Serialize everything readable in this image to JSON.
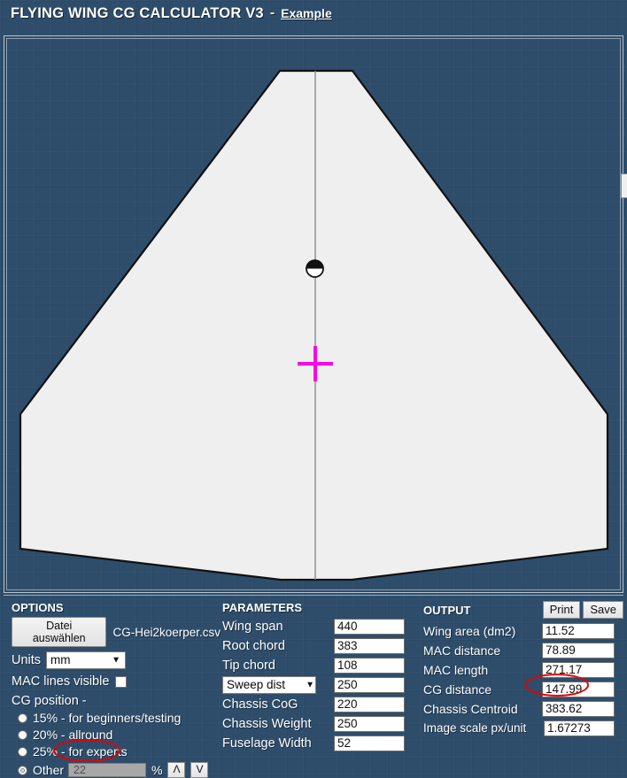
{
  "header": {
    "title": "FLYING WING CG CALCULATOR V3",
    "separator": "-",
    "example_link": "Example"
  },
  "diagram": {
    "markers": {
      "cg_marker": "cg-target-marker",
      "centroid_marker": "magenta-cross-marker"
    },
    "wing_fill": "#efefef",
    "outline_color": "#111111",
    "centerline_color": "#8a8a8a",
    "cross_color": "#ff00e6"
  },
  "options": {
    "title": "OPTIONS",
    "file_button": "Datei auswählen",
    "file_name": "CG-Hei2koerper.csv",
    "units_label": "Units",
    "units_value": "mm",
    "units_options": [
      "mm"
    ],
    "mac_lines_label": "MAC lines visible",
    "mac_lines_checked": false,
    "cg_position_label": "CG position -",
    "cg_options": [
      {
        "label": "15% - for beginners/testing",
        "selected": false
      },
      {
        "label": "20% - allround",
        "selected": false
      },
      {
        "label": "25% - for experts",
        "selected": false
      }
    ],
    "other_label": "Other",
    "other_selected": true,
    "other_value": "22",
    "percent_sign": "%",
    "spin_up": "Λ",
    "spin_down": "V"
  },
  "parameters": {
    "title": "PARAMETERS",
    "rows": [
      {
        "label": "Wing span",
        "value": "440"
      },
      {
        "label": "Root chord",
        "value": "383"
      },
      {
        "label": "Tip chord",
        "value": "108"
      },
      {
        "label": "Sweep dist",
        "value": "250",
        "is_select": true
      },
      {
        "label": "Chassis CoG",
        "value": "220"
      },
      {
        "label": "Chassis Weight",
        "value": "250"
      },
      {
        "label": "Fuselage Width",
        "value": "52"
      }
    ],
    "sweep_options": [
      "Sweep dist"
    ]
  },
  "output": {
    "title": "OUTPUT",
    "print_button": "Print",
    "save_button": "Save",
    "rows": [
      {
        "label": "Wing area (dm2)",
        "value": "11.52"
      },
      {
        "label": "MAC distance",
        "value": "78.89"
      },
      {
        "label": "MAC length",
        "value": "271.17"
      },
      {
        "label": "CG distance",
        "value": "147.99"
      },
      {
        "label": "Chassis Centroid",
        "value": "383.62"
      },
      {
        "label": "Image scale px/unit",
        "value": "1.67273"
      }
    ]
  },
  "annotations": {
    "highlight_color": "#e60000",
    "highlighted_fields": [
      "CG distance",
      "Other percent"
    ]
  }
}
